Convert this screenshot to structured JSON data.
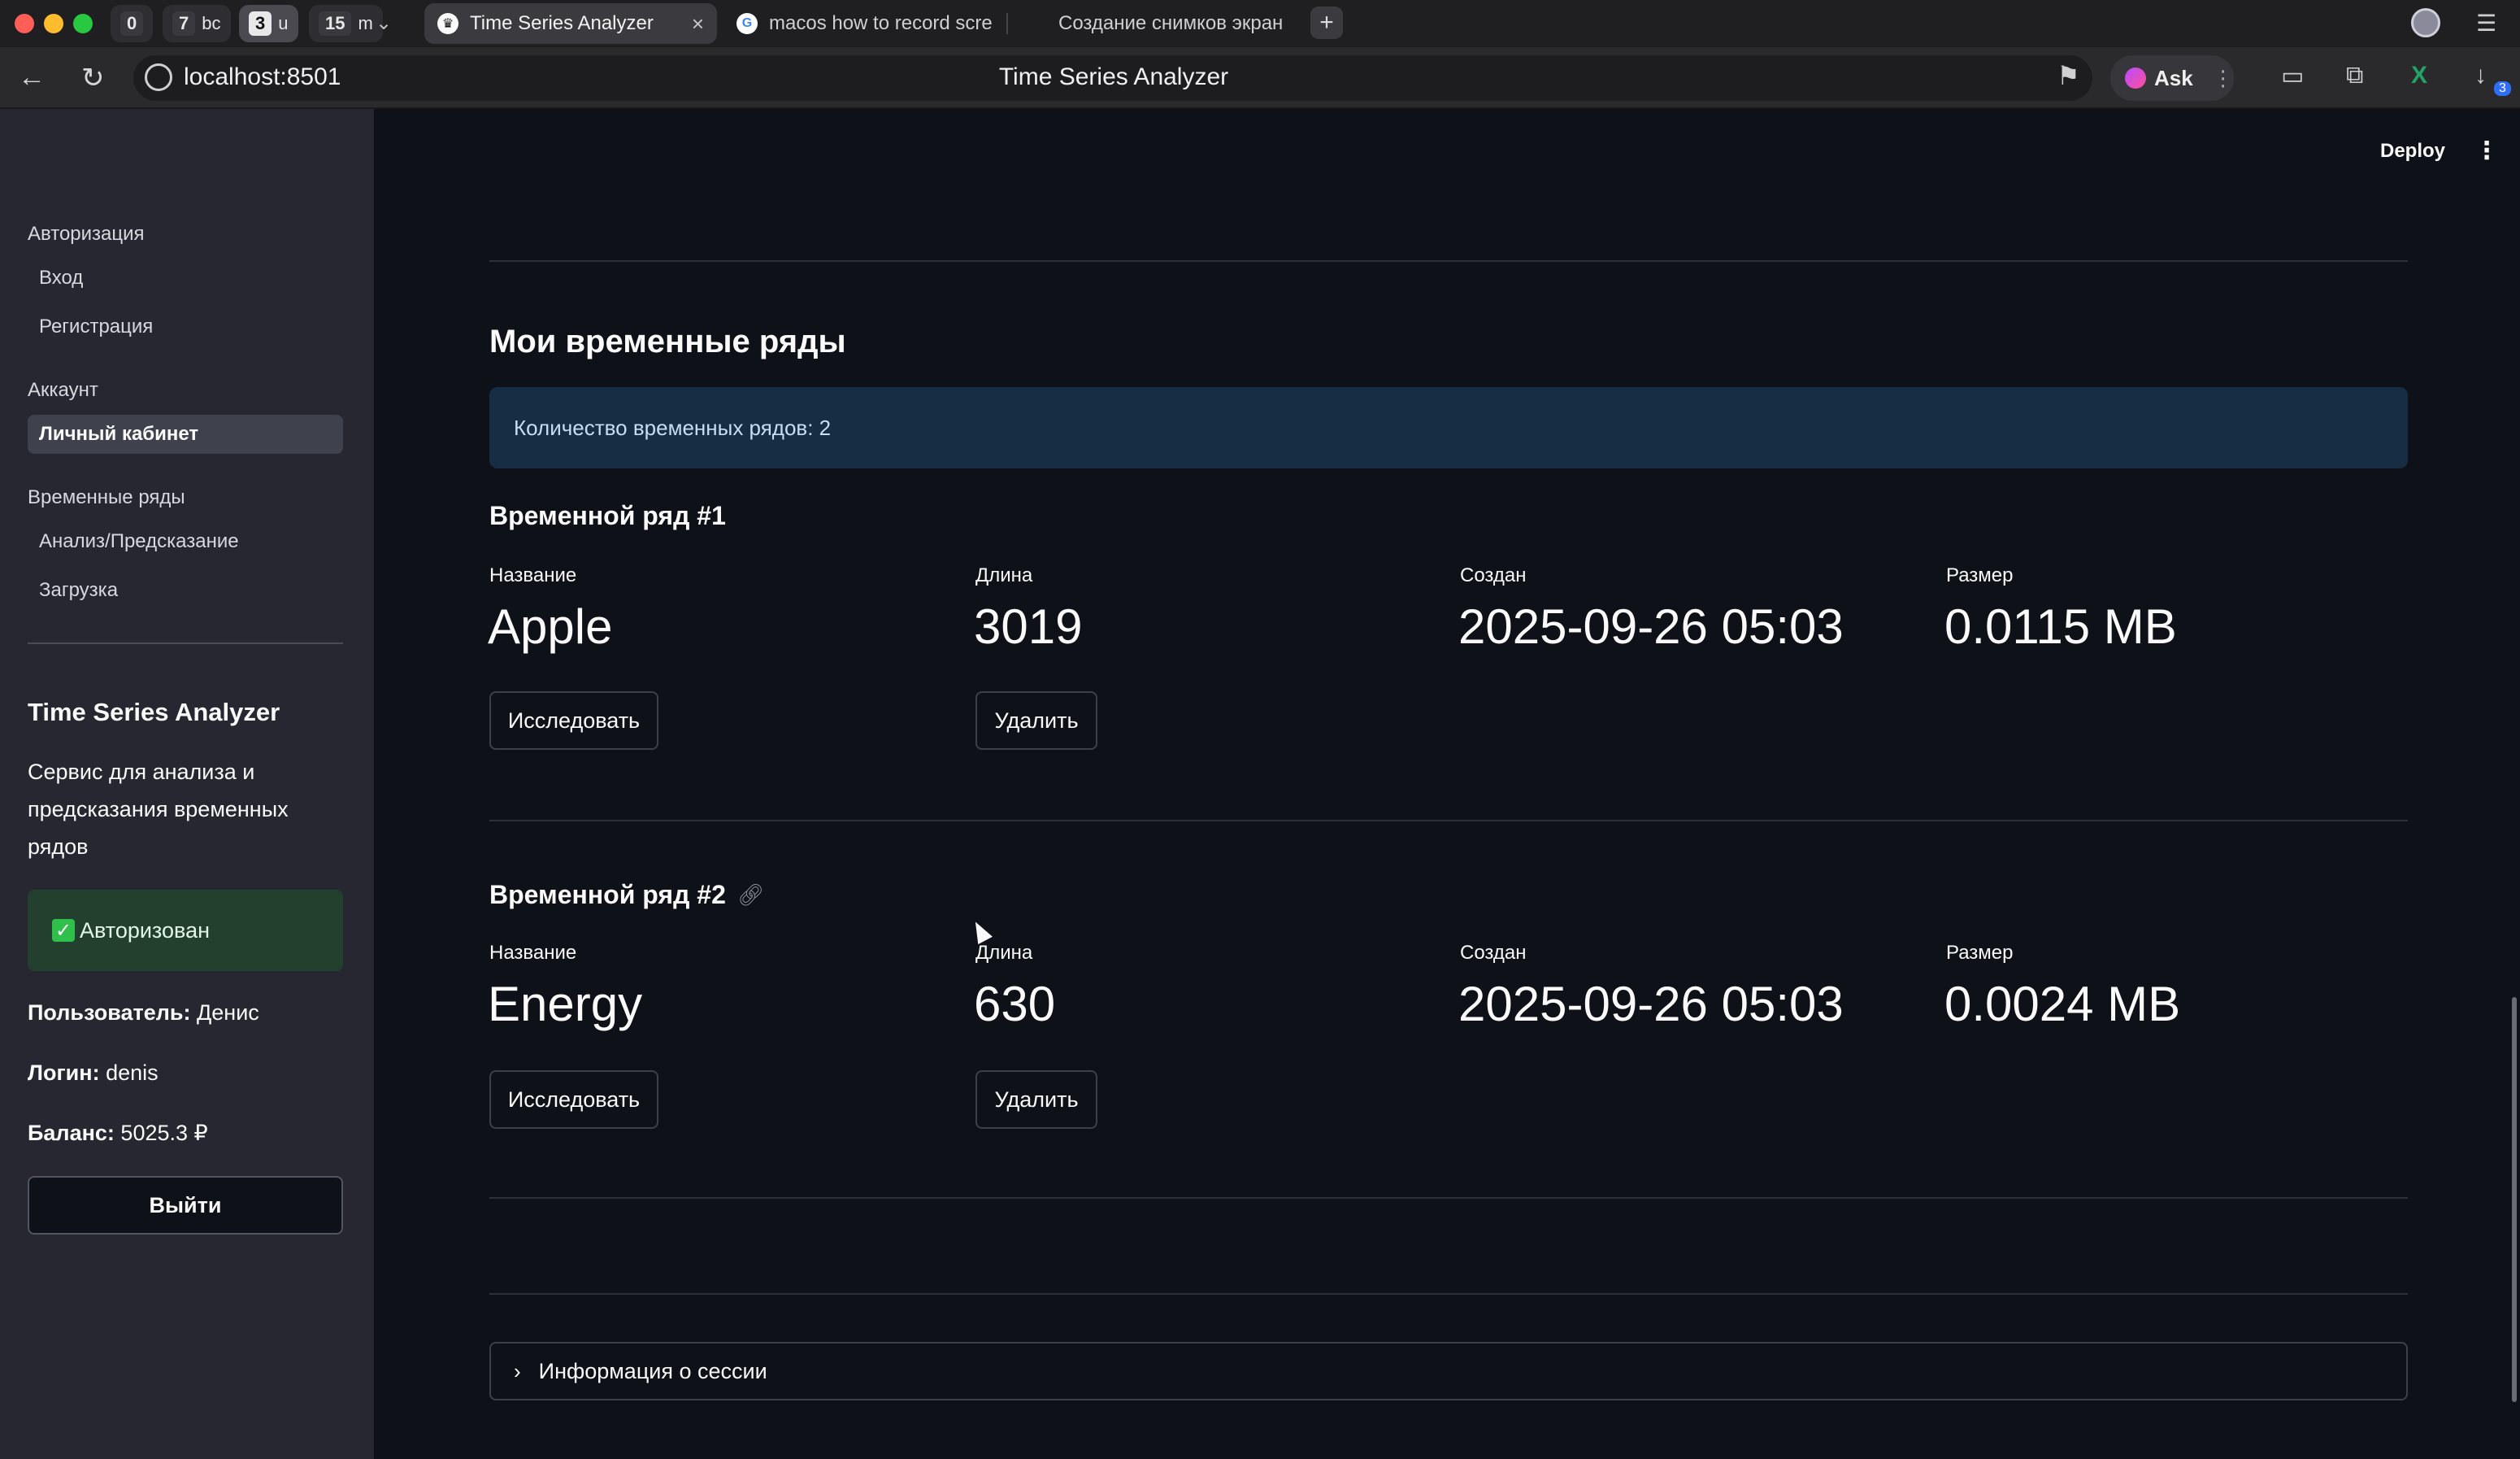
{
  "browser": {
    "tab_groups": [
      {
        "num": "0",
        "label": ""
      },
      {
        "num": "7",
        "label": "bc"
      },
      {
        "num": "3",
        "label": "u"
      },
      {
        "num": "15",
        "label": "m"
      }
    ],
    "tabs": [
      {
        "title": "Time Series Analyzer",
        "active": true
      },
      {
        "title": "macos how to record scre",
        "active": false
      },
      {
        "title": "Создание снимков экран",
        "active": false
      }
    ],
    "url": "localhost:8501",
    "page_title": "Time Series Analyzer",
    "ask_label": "Ask",
    "extension_badge": "3"
  },
  "sidebar": {
    "sections": [
      {
        "title": "Авторизация",
        "items": [
          {
            "label": "Вход",
            "active": false
          },
          {
            "label": "Регистрация",
            "active": false
          }
        ]
      },
      {
        "title": "Аккаунт",
        "items": [
          {
            "label": "Личный кабинет",
            "active": true
          }
        ]
      },
      {
        "title": "Временные ряды",
        "items": [
          {
            "label": "Анализ/Предсказание",
            "active": false
          },
          {
            "label": "Загрузка",
            "active": false
          }
        ]
      }
    ],
    "app_title": "Time Series Analyzer",
    "app_description": "Сервис для анализа и предсказания временных рядов",
    "auth_status": "Авторизован",
    "user_label": "Пользователь:",
    "user_value": "Денис",
    "login_label": "Логин:",
    "login_value": "denis",
    "balance_label": "Баланс:",
    "balance_value": "5025.3 ₽",
    "logout_label": "Выйти"
  },
  "header": {
    "deploy_label": "Deploy"
  },
  "main": {
    "heading": "Мои временные ряды",
    "count_info": "Количество временных рядов: 2",
    "series": [
      {
        "title": "Временной ряд #1",
        "labels": {
          "name": "Название",
          "length": "Длина",
          "created": "Создан",
          "size": "Размер"
        },
        "name": "Apple",
        "length": "3019",
        "created": "2025-09-26 05:03",
        "size": "0.0115 MB",
        "explore_label": "Исследовать",
        "delete_label": "Удалить"
      },
      {
        "title": "Временной ряд #2",
        "labels": {
          "name": "Название",
          "length": "Длина",
          "created": "Создан",
          "size": "Размер"
        },
        "name": "Energy",
        "length": "630",
        "created": "2025-09-26 05:03",
        "size": "0.0024 MB",
        "explore_label": "Исследовать",
        "delete_label": "Удалить"
      }
    ],
    "session_expander": "Информация о сессии"
  }
}
